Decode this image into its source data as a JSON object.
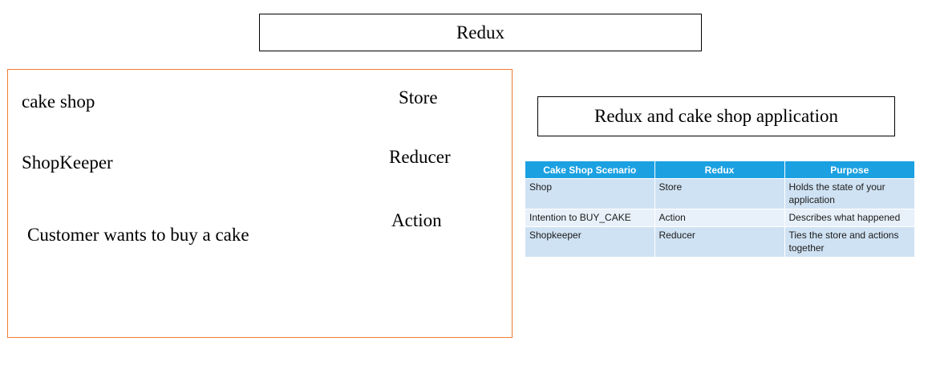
{
  "title": "Redux",
  "subtitle": "Redux and cake shop application",
  "mapping": {
    "left": [
      "cake shop",
      "ShopKeeper",
      "Customer wants to buy a cake"
    ],
    "right": [
      "Store",
      "Reducer",
      "Action"
    ]
  },
  "table": {
    "headers": [
      "Cake Shop Scenario",
      "Redux",
      "Purpose"
    ],
    "rows": [
      [
        "Shop",
        "Store",
        "Holds the state of your application"
      ],
      [
        "Intention to BUY_CAKE",
        "Action",
        "Describes what happened"
      ],
      [
        "Shopkeeper",
        "Reducer",
        "Ties the store and actions together"
      ]
    ]
  },
  "colors": {
    "panel_border": "#ED7D31",
    "table_header": "#1BA1E2",
    "row_dark": "#CFE2F3",
    "row_light": "#E8F1FA"
  }
}
